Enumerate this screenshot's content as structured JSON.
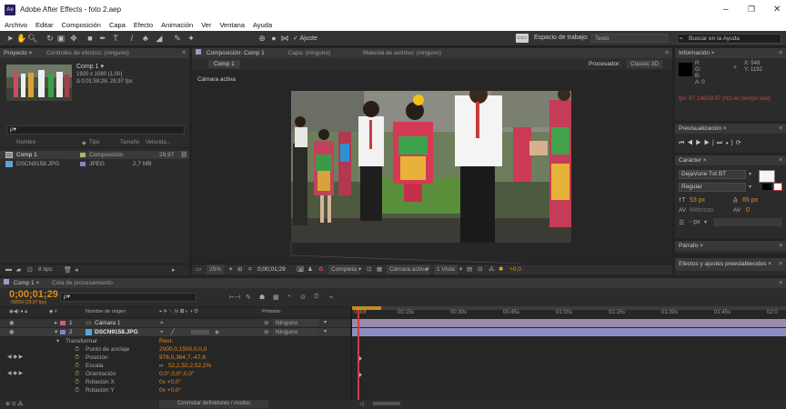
{
  "window": {
    "title": "Adobe After Effects - foto 2.aep",
    "app_icon": "Ae"
  },
  "menu": [
    "Archivo",
    "Editar",
    "Composición",
    "Capa",
    "Efecto",
    "Animación",
    "Ver",
    "Ventana",
    "Ayuda"
  ],
  "toolbar": {
    "ajuste_label": "Ajuste",
    "workspace_label": "Espacio de trabajo:",
    "workspace_value": "Texto",
    "search_placeholder": "Buscar en la Ayuda"
  },
  "project": {
    "tab_project": "Proyecto ×",
    "tab_effects": "Controles de efectos: (ninguno)",
    "selected_name": "Comp 1 ▾",
    "selected_dims": "1920 x 1080 (1,00)",
    "selected_duration": "Δ 0;01;59;28, 29,97 fps",
    "search_placeholder": "ρ▾",
    "col_name": "Nombre",
    "col_type": "Tipo",
    "col_size": "Tamaño",
    "col_speed": "Velocida...",
    "items": [
      {
        "name": "Comp 1",
        "type": "Composición",
        "size": "",
        "speed": "29,97"
      },
      {
        "name": "DSCN9158.JPG",
        "type": "JPEG",
        "size": "2,7 MB",
        "speed": ""
      }
    ],
    "bpc": "8 bpc"
  },
  "composition": {
    "tab_comp": "Composición: Comp 1",
    "tab_layer": "Capa: (ninguno)",
    "tab_footage": "Material de archivo: (ninguno)",
    "comp_tab": "Comp 1",
    "renderer_label": "Procesador:",
    "renderer_value": "Classic 3D",
    "camera_label": "Cámara activa",
    "zoom": "25%",
    "timecode": "0;00;01;29",
    "quality": "Completa",
    "view": "Cámara activa",
    "views": "1 Vista",
    "offset": "+0,0"
  },
  "info": {
    "tab": "Información ×",
    "r": "R:",
    "g": "G:",
    "b": "B:",
    "a": "A: 0",
    "x": "X: 548",
    "y": "Y: 1192",
    "fps": "fps: 67,146/29,97 (NO en tiempo real)"
  },
  "preview": {
    "tab": "Previsualización ×"
  },
  "character": {
    "tab": "Carácter ×",
    "font": "DejaVune Txt BT",
    "style": "Regular",
    "size": "53 px",
    "leading": "65 px",
    "kerning": "Métricas",
    "tracking": "0",
    "stroke": "- px"
  },
  "paragraph": {
    "tab": "Párrafo ×"
  },
  "effects_presets": {
    "tab": "Efectos y ajustes preestablecidos ×"
  },
  "timeline": {
    "tab_comp": "Comp 1 ×",
    "tab_render": "Cola de procesamiento",
    "timecode": "0;00;01;29",
    "frames": "00059 (29,97 fps)",
    "search": "ρ▾",
    "col_name": "Nombre de origen",
    "col_parent": "Primario",
    "ticks": [
      "0:00f",
      "00:15s",
      "00:30s",
      "00:45s",
      "01:00s",
      "01:15s",
      "01:30s",
      "01:45s",
      "02:0"
    ],
    "layers": [
      {
        "num": "1",
        "name": "Cámara 1",
        "parent": "Ninguno"
      },
      {
        "num": "2",
        "name": "DSCN9158.JPG",
        "parent": "Ninguno"
      }
    ],
    "transform": "Transformar",
    "reset": "Rest.",
    "props": [
      {
        "name": "Punto de anclaje",
        "value": "2000,0,1500,0,0,0"
      },
      {
        "name": "Posición",
        "value": "976,0,364,7,-47,6"
      },
      {
        "name": "Escala",
        "value": "52,2,52,2,52,2%"
      },
      {
        "name": "Orientación",
        "value": "0,0°,0,0°,0,0°"
      },
      {
        "name": "Rotación X",
        "value": "0x +0,0°"
      },
      {
        "name": "Rotación Y",
        "value": "0x +0,0°"
      }
    ],
    "footer": "Conmutar definidores / modos"
  }
}
